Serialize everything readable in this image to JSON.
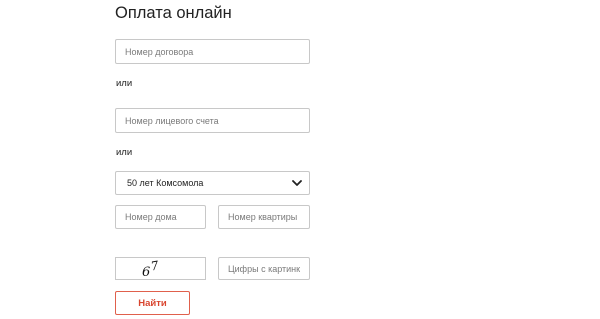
{
  "page_title": "Оплата онлайн",
  "contract_field": {
    "placeholder": "Номер договора"
  },
  "separator_1": "или",
  "account_field": {
    "placeholder": "Номер лицевого счета"
  },
  "separator_2": "или",
  "street_select": {
    "selected": "50 лет Комсомола",
    "icon": "chevron-down-icon"
  },
  "house_field": {
    "placeholder": "Номер дома"
  },
  "apartment_field": {
    "placeholder": "Номер квартиры"
  },
  "captcha": {
    "image_text": "67"
  },
  "captcha_field": {
    "placeholder": "Цифры с картинки"
  },
  "submit": {
    "label": "Найти"
  },
  "colors": {
    "accent": "#d9452f",
    "border": "#c8c8c8",
    "text": "#222222"
  }
}
